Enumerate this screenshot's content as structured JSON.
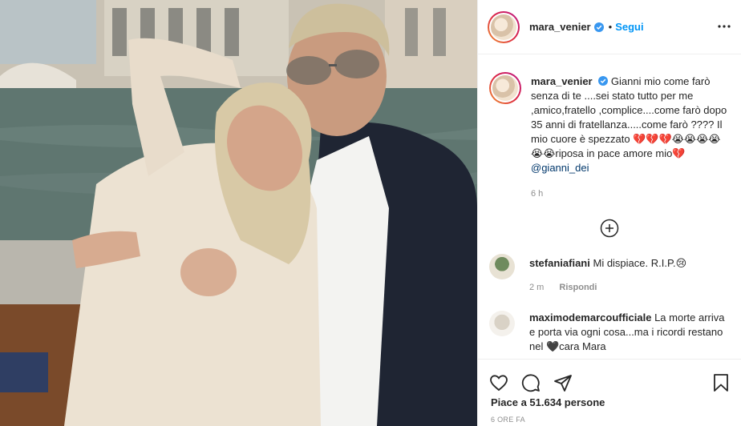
{
  "post": {
    "author": "mara_venier",
    "follow_label": "Segui",
    "separator": "•",
    "caption_text": "Gianni mio come farò senza di te ....sei stato tutto per me ,amico,fratello ,complice....come farò dopo 35 anni di fratellanza.....come farò ???? Il mio cuore è spezzato 💔💔💔😭😭😭😭😭😭riposa in pace amore mio💔 ",
    "caption_mention": "@gianni_dei",
    "caption_time": "6 h"
  },
  "comments": [
    {
      "user": "stefaniafiani",
      "text": "Mi dispiace. R.I.P.😢",
      "time": "2 m",
      "reply_label": "Rispondi"
    },
    {
      "user": "maximodemarcoufficiale",
      "text": "La morte arriva e porta via ogni cosa...ma i ricordi restano nel 🖤cara Mara"
    }
  ],
  "engagement": {
    "likes_text": "Piace a 51.634 persone",
    "timestamp": "6 ORE FA"
  },
  "icons": {
    "verified": "verified-badge-icon",
    "more": "more-options-icon",
    "load_more": "plus-circle-icon",
    "like": "heart-icon",
    "comment": "comment-icon",
    "share": "share-icon",
    "save": "bookmark-icon"
  },
  "colors": {
    "accent": "#0095f6",
    "text": "#262626",
    "muted": "#8e8e8e",
    "mention": "#00376b"
  }
}
